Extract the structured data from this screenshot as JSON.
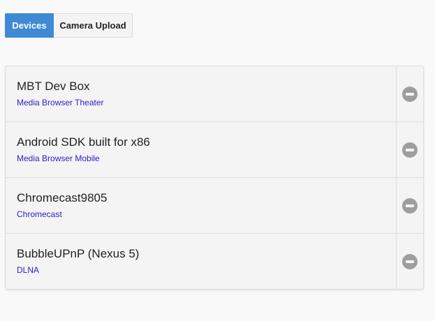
{
  "tabs": [
    {
      "label": "Devices",
      "active": true
    },
    {
      "label": "Camera Upload",
      "active": false
    }
  ],
  "devices": [
    {
      "name": "MBT Dev Box",
      "app": "Media Browser Theater",
      "action_icon": "remove-circle-icon"
    },
    {
      "name": "Android SDK built for x86",
      "app": "Media Browser Mobile",
      "action_icon": "remove-circle-icon"
    },
    {
      "name": "Chromecast9805",
      "app": "Chromecast",
      "action_icon": "remove-circle-icon"
    },
    {
      "name": "BubbleUPnP (Nexus 5)",
      "app": "DLNA",
      "action_icon": "remove-circle-icon"
    }
  ],
  "colors": {
    "accent": "#3e8ad5",
    "app_link": "#2a22c8",
    "icon": "#9e9e9e",
    "background": "#f9f9f9"
  }
}
